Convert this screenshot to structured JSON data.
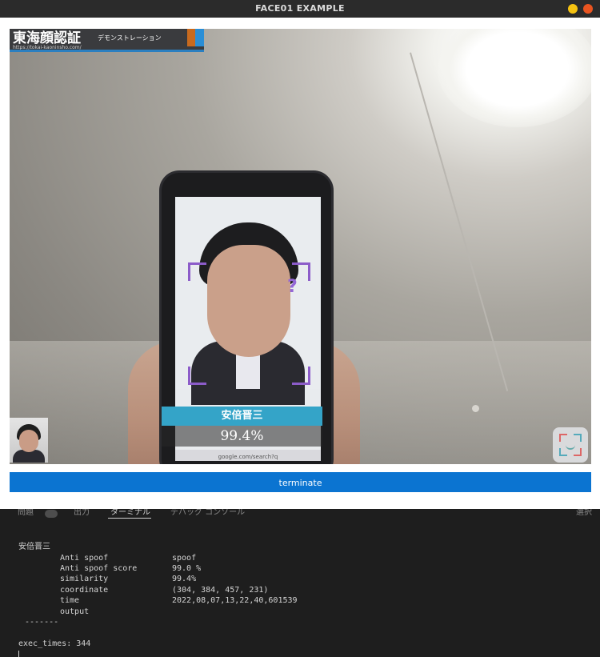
{
  "window": {
    "title": "FACE01 EXAMPLE",
    "controls": {
      "minimize_color": "#f5c211",
      "close_color": "#e95420"
    }
  },
  "camera": {
    "logo": {
      "title": "東海顔認証",
      "subtitle": "デモンストレーション",
      "url": "https://tokai-kaoninsho.com/"
    },
    "detection": {
      "name": "安倍晋三",
      "percentage": "99.4%",
      "box_color": "#8c5cc9",
      "label_color": "#34a4c8"
    },
    "phone_url": "google.com/search?q"
  },
  "terminate_button": {
    "label": "terminate",
    "color": "#0b74d1"
  },
  "panel_tabs": [
    "問題",
    "出力",
    "ターミナル",
    "デバッグ コンソール",
    "選択"
  ],
  "terminal": {
    "name": "安倍晋三",
    "rows": [
      {
        "key": "Anti spoof",
        "value": "spoof"
      },
      {
        "key": "Anti spoof score",
        "value": "99.0 %"
      },
      {
        "key": "similarity",
        "value": "99.4%"
      },
      {
        "key": "coordinate",
        "value": "(304, 384, 457, 231)"
      },
      {
        "key": "time",
        "value": "2022,08,07,13,22,40,601539"
      },
      {
        "key": "output",
        "value": ""
      }
    ],
    "separator": "-------",
    "exec_times": "exec_times: 344"
  }
}
